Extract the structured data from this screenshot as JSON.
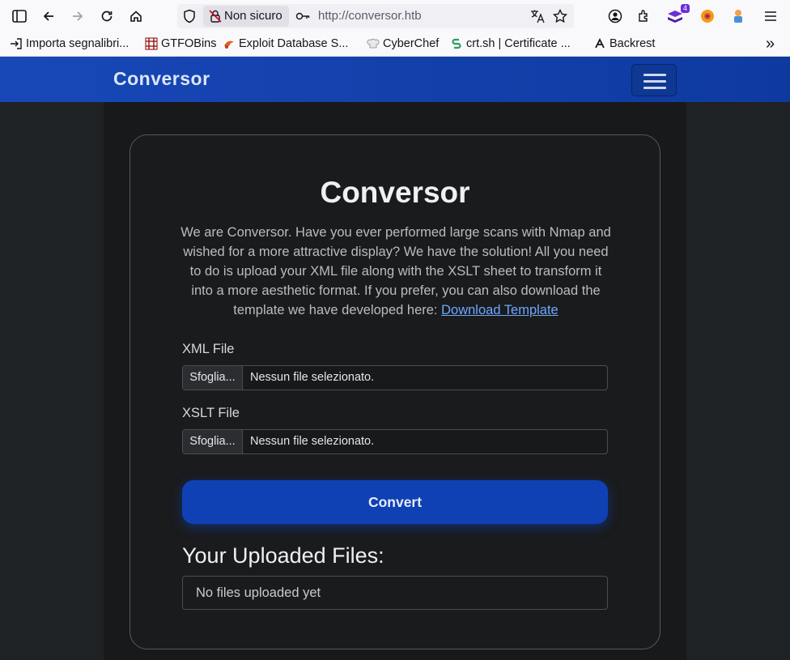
{
  "browser": {
    "security_label": "Non sicuro",
    "url": "http://conversor.htb",
    "extension_badge": "4",
    "bookmarks": [
      {
        "label": "Importa segnalibri..."
      },
      {
        "label": "GTFOBins"
      },
      {
        "label": "Exploit Database S..."
      },
      {
        "label": "CyberChef"
      },
      {
        "label": "crt.sh | Certificate ..."
      },
      {
        "label": "Backrest"
      }
    ],
    "overflow_label": "»"
  },
  "navbar": {
    "brand": "Conversor"
  },
  "card": {
    "title": "Conversor",
    "description": "We are Conversor. Have you ever performed large scans with Nmap and wished for a more attractive display? We have the solution! All you need to do is upload your XML file along with the XSLT sheet to transform it into a more aesthetic format. If you prefer, you can also download the template we have developed here: ",
    "download_link": "Download Template",
    "xml_label": "XML File",
    "xslt_label": "XSLT File",
    "browse_label": "Sfoglia...",
    "no_file_text": "Nessun file selezionato.",
    "convert_label": "Convert",
    "uploaded_title": "Your Uploaded Files:",
    "uploaded_empty": "No files uploaded yet"
  },
  "colors": {
    "navbar": "#1848b8",
    "button": "#0f41b5",
    "link": "#6ea8fe",
    "page_bg": "#18191b"
  }
}
